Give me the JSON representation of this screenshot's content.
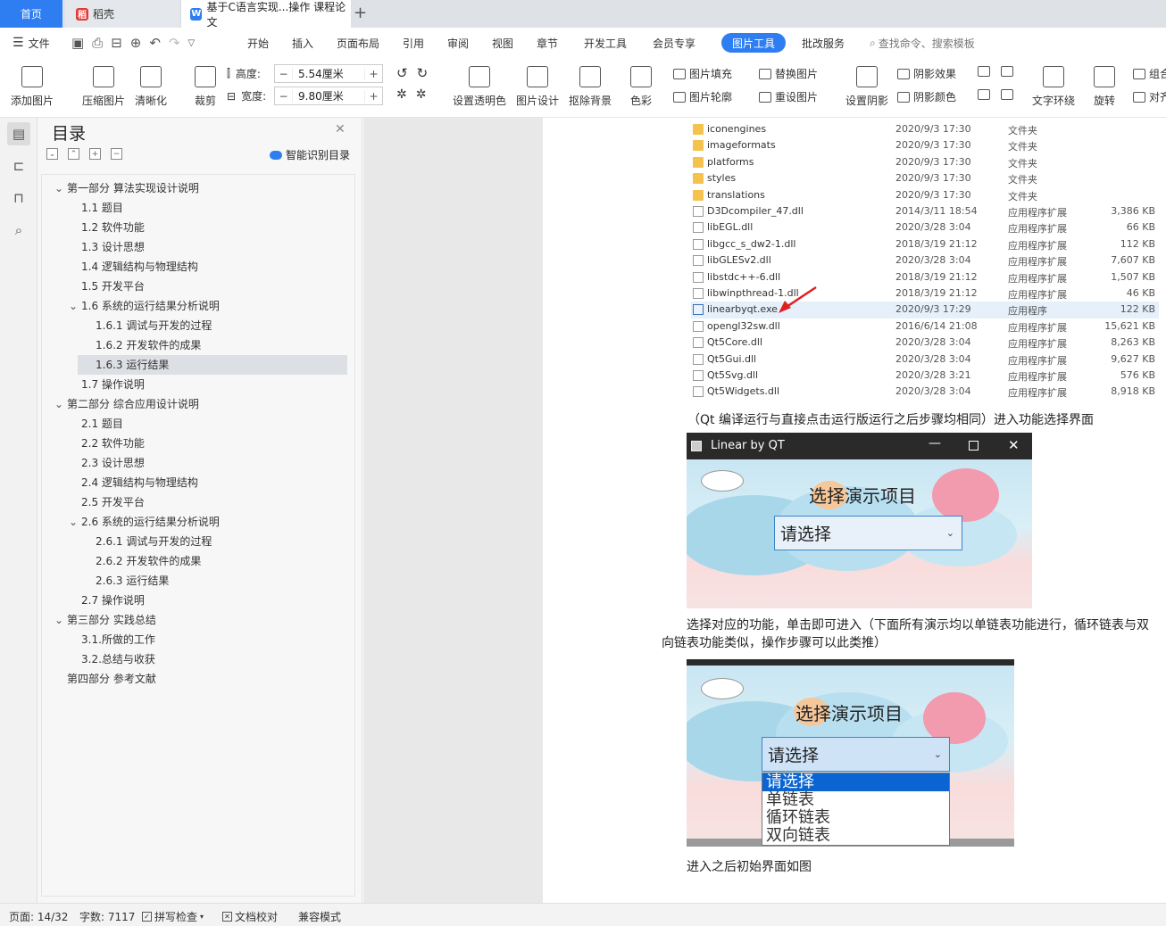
{
  "tabs": {
    "home": "首页",
    "docer": "稻壳",
    "active": "基于C语言实现...操作 课程论文"
  },
  "menu": {
    "file": "文件",
    "items": [
      "开始",
      "插入",
      "页面布局",
      "引用",
      "审阅",
      "视图",
      "章节",
      "开发工具",
      "会员专享",
      "图片工具",
      "批改服务"
    ],
    "search": "查找命令、搜索模板"
  },
  "toolbar": {
    "add_image": "添加图片",
    "compress": "压缩图片",
    "sharpen": "清晰化",
    "crop": "裁剪",
    "height_label": "高度:",
    "height_value": "5.54厘米",
    "width_label": "宽度:",
    "width_value": "9.80厘米",
    "transparent": "设置透明色",
    "image_design": "图片设计",
    "remove_bg": "抠除背景",
    "color": "色彩",
    "image_fill": "图片填充",
    "image_outline": "图片轮廓",
    "replace_image": "替换图片",
    "reset_image": "重设图片",
    "set_shadow": "设置阴影",
    "shadow_effect": "阴影效果",
    "shadow_color": "阴影颜色",
    "text_wrap": "文字环绕",
    "rotate": "旋转",
    "group": "组合",
    "align": "对齐"
  },
  "toc": {
    "title": "目录",
    "smart": "智能识别目录",
    "items": [
      {
        "text": "第一部分  算法实现设计说明",
        "level": 0,
        "arrow": true
      },
      {
        "text": "1.1 题目",
        "level": 1
      },
      {
        "text": "1.2 软件功能",
        "level": 1
      },
      {
        "text": "1.3 设计思想",
        "level": 1
      },
      {
        "text": "1.4 逻辑结构与物理结构",
        "level": 1
      },
      {
        "text": "1.5 开发平台",
        "level": 1
      },
      {
        "text": "1.6 系统的运行结果分析说明",
        "level": 1,
        "arrow": true
      },
      {
        "text": "1.6.1  调试与开发的过程",
        "level": 2
      },
      {
        "text": "1.6.2  开发软件的成果",
        "level": 2
      },
      {
        "text": "1.6.3  运行结果",
        "level": 2,
        "selected": true
      },
      {
        "text": "1.7 操作说明",
        "level": 1
      },
      {
        "text": "第二部分  综合应用设计说明",
        "level": 0,
        "arrow": true
      },
      {
        "text": "2.1 题目",
        "level": 1
      },
      {
        "text": "2.2 软件功能",
        "level": 1
      },
      {
        "text": "2.3 设计思想",
        "level": 1
      },
      {
        "text": "2.4 逻辑结构与物理结构",
        "level": 1
      },
      {
        "text": "2.5 开发平台",
        "level": 1
      },
      {
        "text": "2.6 系统的运行结果分析说明",
        "level": 1,
        "arrow": true
      },
      {
        "text": "2.6.1  调试与开发的过程",
        "level": 2
      },
      {
        "text": "2.6.2  开发软件的成果",
        "level": 2
      },
      {
        "text": "2.6.3  运行结果",
        "level": 2
      },
      {
        "text": "2.7 操作说明",
        "level": 1
      },
      {
        "text": "第三部分  实践总结",
        "level": 0,
        "arrow": true
      },
      {
        "text": "3.1.所做的工作",
        "level": 1
      },
      {
        "text": "3.2.总结与收获",
        "level": 1
      },
      {
        "text": "第四部分  参考文献",
        "level": 0
      }
    ]
  },
  "files": [
    {
      "name": "iconengines",
      "date": "2020/9/3 17:30",
      "type": "文件夹",
      "size": "",
      "kind": "folder"
    },
    {
      "name": "imageformats",
      "date": "2020/9/3 17:30",
      "type": "文件夹",
      "size": "",
      "kind": "folder"
    },
    {
      "name": "platforms",
      "date": "2020/9/3 17:30",
      "type": "文件夹",
      "size": "",
      "kind": "folder"
    },
    {
      "name": "styles",
      "date": "2020/9/3 17:30",
      "type": "文件夹",
      "size": "",
      "kind": "folder"
    },
    {
      "name": "translations",
      "date": "2020/9/3 17:30",
      "type": "文件夹",
      "size": "",
      "kind": "folder"
    },
    {
      "name": "D3Dcompiler_47.dll",
      "date": "2014/3/11 18:54",
      "type": "应用程序扩展",
      "size": "3,386 KB",
      "kind": "file"
    },
    {
      "name": "libEGL.dll",
      "date": "2020/3/28 3:04",
      "type": "应用程序扩展",
      "size": "66 KB",
      "kind": "file"
    },
    {
      "name": "libgcc_s_dw2-1.dll",
      "date": "2018/3/19 21:12",
      "type": "应用程序扩展",
      "size": "112 KB",
      "kind": "file"
    },
    {
      "name": "libGLESv2.dll",
      "date": "2020/3/28 3:04",
      "type": "应用程序扩展",
      "size": "7,607 KB",
      "kind": "file"
    },
    {
      "name": "libstdc++-6.dll",
      "date": "2018/3/19 21:12",
      "type": "应用程序扩展",
      "size": "1,507 KB",
      "kind": "file"
    },
    {
      "name": "libwinpthread-1.dll",
      "date": "2018/3/19 21:12",
      "type": "应用程序扩展",
      "size": "46 KB",
      "kind": "file"
    },
    {
      "name": "linearbyqt.exe",
      "date": "2020/9/3 17:29",
      "type": "应用程序",
      "size": "122 KB",
      "kind": "exe",
      "highlight": true
    },
    {
      "name": "opengl32sw.dll",
      "date": "2016/6/14 21:08",
      "type": "应用程序扩展",
      "size": "15,621 KB",
      "kind": "file"
    },
    {
      "name": "Qt5Core.dll",
      "date": "2020/3/28 3:04",
      "type": "应用程序扩展",
      "size": "8,263 KB",
      "kind": "file"
    },
    {
      "name": "Qt5Gui.dll",
      "date": "2020/3/28 3:04",
      "type": "应用程序扩展",
      "size": "9,627 KB",
      "kind": "file"
    },
    {
      "name": "Qt5Svg.dll",
      "date": "2020/3/28 3:21",
      "type": "应用程序扩展",
      "size": "576 KB",
      "kind": "file"
    },
    {
      "name": "Qt5Widgets.dll",
      "date": "2020/3/28 3:04",
      "type": "应用程序扩展",
      "size": "8,918 KB",
      "kind": "file"
    }
  ],
  "doc": {
    "para1": "（Qt 编译运行与直接点击运行版运行之后步骤均相同）进入功能选择界面",
    "para2_line1": "选择对应的功能，单击即可进入（下面所有演示均以单链表功能进行，循环链表与双",
    "para2_line2": "向链表功能类似，操作步骤可以此类推）",
    "para3": "进入之后初始界面如图"
  },
  "qtwin1": {
    "title": "Linear by QT",
    "heading": "选择演示项目",
    "combo": "请选择"
  },
  "qtwin2": {
    "heading": "选择演示项目",
    "combo": "请选择",
    "options": [
      "请选择",
      "单链表",
      "循环链表",
      "双向链表"
    ]
  },
  "status": {
    "page": "页面: 14/32",
    "words": "字数: 7117",
    "spell": "拼写检查",
    "proof": "文档校对",
    "compat": "兼容模式"
  },
  "colors": {
    "accent": "#2e7ef2",
    "qt_selection": "#0a64d2",
    "arrow": "#e02020"
  }
}
